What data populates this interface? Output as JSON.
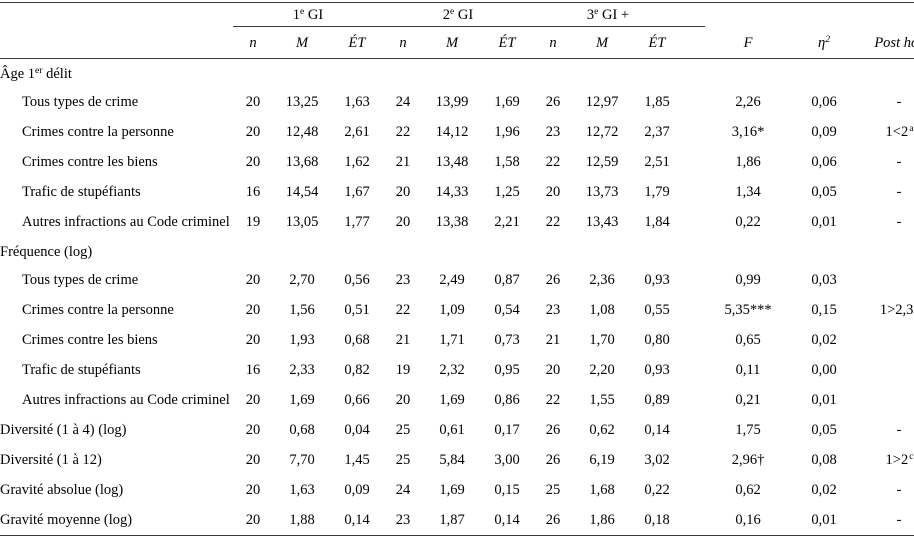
{
  "table": {
    "columns": {
      "groups": [
        {
          "label": "1e GI",
          "ordinal_base": "1",
          "ordinal_sup": "e",
          "suffix": " GI"
        },
        {
          "label": "2e GI",
          "ordinal_base": "2",
          "ordinal_sup": "e",
          "suffix": " GI"
        },
        {
          "label": "3e GI +",
          "ordinal_base": "3",
          "ordinal_sup": "e",
          "suffix": " GI +"
        }
      ],
      "sub_headers": [
        "n",
        "M",
        "ÉT"
      ],
      "stat_headers": {
        "f": "F",
        "eta": "η",
        "eta_sup": "2",
        "post_hoc": "Post hoc"
      }
    },
    "sections": [
      {
        "heading": "Âge 1er délit",
        "heading_base": "Âge 1",
        "heading_sup": "er",
        "heading_rest": " délit",
        "rows": [
          {
            "label": "Tous types de crime",
            "g1": {
              "n": "20",
              "m": "13,25",
              "et": "1,63"
            },
            "g2": {
              "n": "24",
              "m": "13,99",
              "et": "1,69"
            },
            "g3": {
              "n": "26",
              "m": "12,97",
              "et": "1,85"
            },
            "f": "2,26",
            "eta": "0,06",
            "post_hoc": "-",
            "post_hoc_sup": ""
          },
          {
            "label": "Crimes contre la personne",
            "g1": {
              "n": "20",
              "m": "12,48",
              "et": "2,61"
            },
            "g2": {
              "n": "22",
              "m": "14,12",
              "et": "1,96"
            },
            "g3": {
              "n": "23",
              "m": "12,72",
              "et": "2,37"
            },
            "f": "3,16*",
            "eta": "0,09",
            "post_hoc": "1<2",
            "post_hoc_sup": "a"
          },
          {
            "label": "Crimes contre les biens",
            "g1": {
              "n": "20",
              "m": "13,68",
              "et": "1,62"
            },
            "g2": {
              "n": "21",
              "m": "13,48",
              "et": "1,58"
            },
            "g3": {
              "n": "22",
              "m": "12,59",
              "et": "2,51"
            },
            "f": "1,86",
            "eta": "0,06",
            "post_hoc": "-",
            "post_hoc_sup": ""
          },
          {
            "label": "Trafic de stupéfiants",
            "g1": {
              "n": "16",
              "m": "14,54",
              "et": "1,67"
            },
            "g2": {
              "n": "20",
              "m": "14,33",
              "et": "1,25"
            },
            "g3": {
              "n": "20",
              "m": "13,73",
              "et": "1,79"
            },
            "f": "1,34",
            "eta": "0,05",
            "post_hoc": "-",
            "post_hoc_sup": ""
          },
          {
            "label": "Autres infractions au Code criminel",
            "g1": {
              "n": "19",
              "m": "13,05",
              "et": "1,77"
            },
            "g2": {
              "n": "20",
              "m": "13,38",
              "et": "2,21"
            },
            "g3": {
              "n": "22",
              "m": "13,43",
              "et": "1,84"
            },
            "f": "0,22",
            "eta": "0,01",
            "post_hoc": "-",
            "post_hoc_sup": ""
          }
        ]
      },
      {
        "heading": "Fréquence (log)",
        "heading_base": "Fréquence (log)",
        "heading_sup": "",
        "heading_rest": "",
        "rows": [
          {
            "label": "Tous types de crime",
            "g1": {
              "n": "20",
              "m": "2,70",
              "et": "0,56"
            },
            "g2": {
              "n": "23",
              "m": "2,49",
              "et": "0,87"
            },
            "g3": {
              "n": "26",
              "m": "2,36",
              "et": "0,93"
            },
            "f": "0,99",
            "eta": "0,03",
            "post_hoc": "",
            "post_hoc_sup": ""
          },
          {
            "label": "Crimes contre la personne",
            "g1": {
              "n": "20",
              "m": "1,56",
              "et": "0,51"
            },
            "g2": {
              "n": "22",
              "m": "1,09",
              "et": "0,54"
            },
            "g3": {
              "n": "23",
              "m": "1,08",
              "et": "0,55"
            },
            "f": "5,35***",
            "eta": "0,15",
            "post_hoc": "1>2,3",
            "post_hoc_sup": "b"
          },
          {
            "label": "Crimes contre les biens",
            "g1": {
              "n": "20",
              "m": "1,93",
              "et": "0,68"
            },
            "g2": {
              "n": "21",
              "m": "1,71",
              "et": "0,73"
            },
            "g3": {
              "n": "21",
              "m": "1,70",
              "et": "0,80"
            },
            "f": "0,65",
            "eta": "0,02",
            "post_hoc": "",
            "post_hoc_sup": ""
          },
          {
            "label": "Trafic de stupéfiants",
            "g1": {
              "n": "16",
              "m": "2,33",
              "et": "0,82"
            },
            "g2": {
              "n": "19",
              "m": "2,32",
              "et": "0,95"
            },
            "g3": {
              "n": "20",
              "m": "2,20",
              "et": "0,93"
            },
            "f": "0,11",
            "eta": "0,00",
            "post_hoc": "",
            "post_hoc_sup": ""
          },
          {
            "label": "Autres infractions au Code criminel",
            "g1": {
              "n": "20",
              "m": "1,69",
              "et": "0,66"
            },
            "g2": {
              "n": "20",
              "m": "1,69",
              "et": "0,86"
            },
            "g3": {
              "n": "22",
              "m": "1,55",
              "et": "0,89"
            },
            "f": "0,21",
            "eta": "0,01",
            "post_hoc": "",
            "post_hoc_sup": ""
          }
        ]
      }
    ],
    "standalone_rows": [
      {
        "label": "Diversité (1 à 4) (log)",
        "g1": {
          "n": "20",
          "m": "0,68",
          "et": "0,04"
        },
        "g2": {
          "n": "25",
          "m": "0,61",
          "et": "0,17"
        },
        "g3": {
          "n": "26",
          "m": "0,62",
          "et": "0,14"
        },
        "f": "1,75",
        "eta": "0,05",
        "post_hoc": "-",
        "post_hoc_sup": ""
      },
      {
        "label": "Diversité (1 à 12)",
        "g1": {
          "n": "20",
          "m": "7,70",
          "et": "1,45"
        },
        "g2": {
          "n": "25",
          "m": "5,84",
          "et": "3,00"
        },
        "g3": {
          "n": "26",
          "m": "6,19",
          "et": "3,02"
        },
        "f": "2,96†",
        "eta": "0,08",
        "post_hoc": "1>2",
        "post_hoc_sup": "c"
      },
      {
        "label": "Gravité absolue (log)",
        "g1": {
          "n": "20",
          "m": "1,63",
          "et": "0,09"
        },
        "g2": {
          "n": "24",
          "m": "1,69",
          "et": "0,15"
        },
        "g3": {
          "n": "25",
          "m": "1,68",
          "et": "0,22"
        },
        "f": "0,62",
        "eta": "0,02",
        "post_hoc": "-",
        "post_hoc_sup": ""
      },
      {
        "label": "Gravité moyenne (log)",
        "g1": {
          "n": "20",
          "m": "1,88",
          "et": "0,14"
        },
        "g2": {
          "n": "23",
          "m": "1,87",
          "et": "0,14"
        },
        "g3": {
          "n": "26",
          "m": "1,86",
          "et": "0,18"
        },
        "f": "0,16",
        "eta": "0,01",
        "post_hoc": "-",
        "post_hoc_sup": ""
      }
    ]
  },
  "colors": {
    "rule": "#3a3a3a",
    "text": "#000000",
    "background": "#ffffff"
  }
}
